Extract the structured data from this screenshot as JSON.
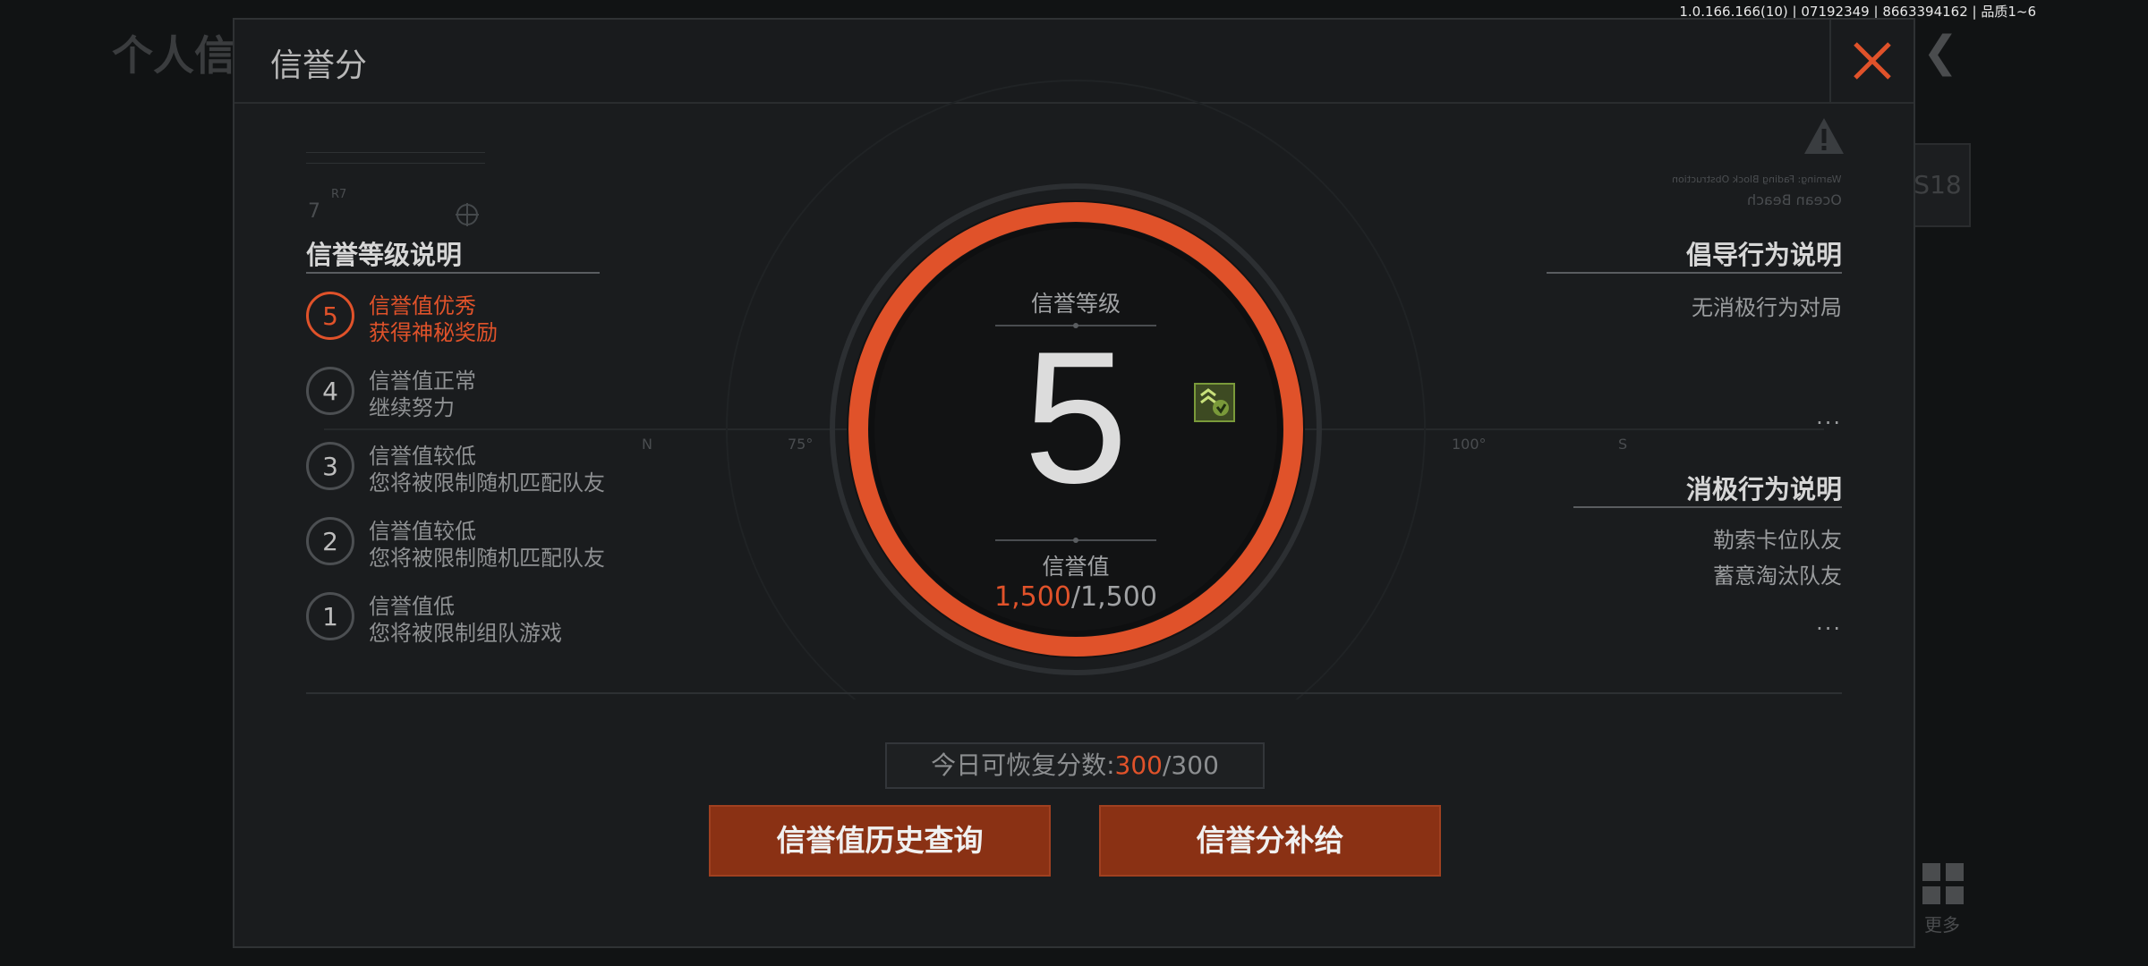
{
  "version": "1.0.166.166(10) | 07192349 | 8663394162 | 品质1~6",
  "background": {
    "page_title": "个人信",
    "side_badge": "S18",
    "more_label": "更多"
  },
  "dialog": {
    "title": "信誉分",
    "level_section": {
      "title": "信誉等级说明",
      "levels": [
        {
          "number": "5",
          "line1": "信誉值优秀",
          "line2": "获得神秘奖励",
          "active": true
        },
        {
          "number": "4",
          "line1": "信誉值正常",
          "line2": "继续努力",
          "active": false
        },
        {
          "number": "3",
          "line1": "信誉值较低",
          "line2": "您将被限制随机匹配队友",
          "active": false
        },
        {
          "number": "2",
          "line1": "信誉值较低",
          "line2": "您将被限制随机匹配队友",
          "active": false
        },
        {
          "number": "1",
          "line1": "信誉值低",
          "line2": "您将被限制组队游戏",
          "active": false
        }
      ]
    },
    "center": {
      "level_label": "信誉等级",
      "level_value": "5",
      "score_label": "信誉值",
      "score_current": "1,500",
      "score_max": "/1,500"
    },
    "encourage_section": {
      "title": "倡导行为说明",
      "items": [
        "无消极行为对局"
      ],
      "more": "..."
    },
    "negative_section": {
      "title": "消极行为说明",
      "items": [
        "勒索卡位队友",
        "蓄意淘汰队友"
      ],
      "more": "..."
    },
    "hud": {
      "n": "N",
      "t75": "75°",
      "t100": "100°",
      "s": "S",
      "r7": "7",
      "warning_text": "Warning: Fading Block Obstruction",
      "ocean": "Ocean Beach"
    },
    "recover": {
      "label": "今日可恢复分数:",
      "current": "300",
      "max": "/300"
    },
    "buttons": {
      "history": "信誉值历史查询",
      "supply": "信誉分补给"
    }
  },
  "colors": {
    "accent": "#e0522a",
    "button": "#8a3114",
    "panel": "#1a1c1e"
  }
}
